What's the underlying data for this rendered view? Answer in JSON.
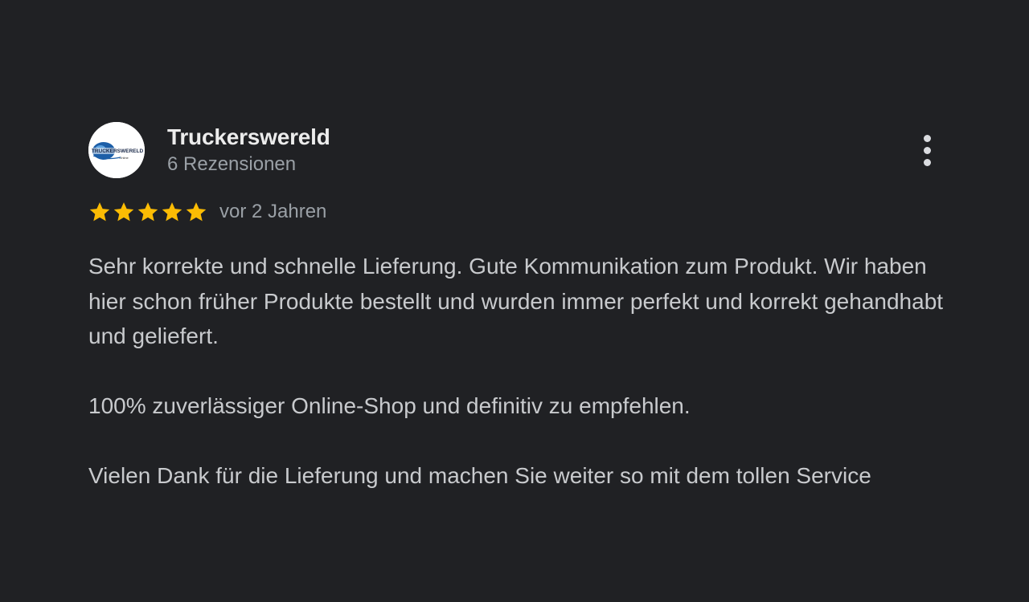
{
  "review": {
    "author": {
      "name": "Truckerswereld",
      "meta": "6 Rezensionen",
      "avatar_icon": "truckerswereld-logo",
      "avatar_text": "TRUCKERSWERELD",
      "avatar_subtext": "Online"
    },
    "menu_icon": "more-vert-icon",
    "rating": {
      "stars": 5,
      "max": 5,
      "star_color": "#fbbc04",
      "date": "vor 2 Jahren"
    },
    "paragraphs": [
      "Sehr korrekte und schnelle Lieferung. Gute Kommunikation zum Produkt. Wir haben hier schon früher Produkte bestellt und wurden immer perfekt und korrekt gehandhabt und geliefert.",
      "100% zuverlässiger Online-Shop und definitiv zu empfehlen.",
      "Vielen Dank für die Lieferung und machen Sie weiter so mit dem tollen Service"
    ]
  },
  "colors": {
    "background": "#202124",
    "name": "#ececec",
    "secondary": "#9aa0a6",
    "body": "#c8cacd"
  }
}
